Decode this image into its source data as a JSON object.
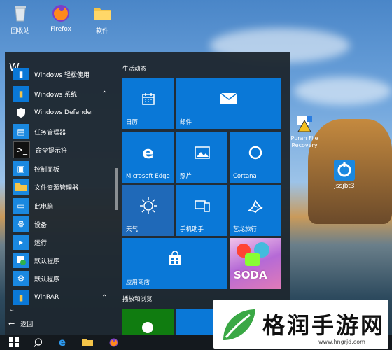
{
  "desktop": {
    "icons": [
      {
        "label": "回收站"
      },
      {
        "label": "Firefox"
      },
      {
        "label": "软件"
      },
      {
        "label": "Puran File Recovery"
      },
      {
        "label": "jssjbt3"
      }
    ]
  },
  "start_menu": {
    "letter_header": "W",
    "apps": [
      {
        "label": "Windows 轻松使用",
        "icon": "folder-icon"
      },
      {
        "label": "Windows 系统",
        "icon": "folder-icon",
        "expanded": true
      },
      {
        "label": "Windows Defender",
        "icon": "shield-icon"
      },
      {
        "label": "任务管理器",
        "icon": "task-manager-icon"
      },
      {
        "label": "命令提示符",
        "icon": "command-prompt-icon"
      },
      {
        "label": "控制面板",
        "icon": "control-panel-icon"
      },
      {
        "label": "文件资源管理器",
        "icon": "folder-icon"
      },
      {
        "label": "此电脑",
        "icon": "computer-icon"
      },
      {
        "label": "设备",
        "icon": "gear-icon"
      },
      {
        "label": "运行",
        "icon": "run-icon"
      },
      {
        "label": "默认程序",
        "icon": "default-programs-icon"
      },
      {
        "label": "默认程序",
        "icon": "gear-icon"
      },
      {
        "label": "WinRAR",
        "icon": "folder-icon"
      }
    ],
    "back_label": "返回",
    "group_life": "生活动态",
    "group_play": "播放和浏览",
    "tiles": [
      {
        "label": "日历",
        "icon": "calendar-icon"
      },
      {
        "label": "邮件",
        "icon": "mail-icon"
      },
      {
        "label": "Microsoft Edge",
        "icon": "edge-icon"
      },
      {
        "label": "照片",
        "icon": "photo-icon"
      },
      {
        "label": "Cortana",
        "icon": "cortana-icon"
      },
      {
        "label": "天气",
        "icon": "sun-icon"
      },
      {
        "label": "手机助手",
        "icon": "phone-icon"
      },
      {
        "label": "艺龙旅行",
        "icon": "elong-icon"
      },
      {
        "label": "应用商店",
        "icon": "store-icon"
      },
      {
        "label": "SODA",
        "icon": "candy-crush-icon"
      }
    ]
  },
  "watermark": {
    "title": "格润手游网",
    "url": "www.hngrjd.com"
  },
  "colors": {
    "tile": "#0a78d7",
    "start_bg": "#1e2830",
    "taskbar": "#14191e"
  }
}
